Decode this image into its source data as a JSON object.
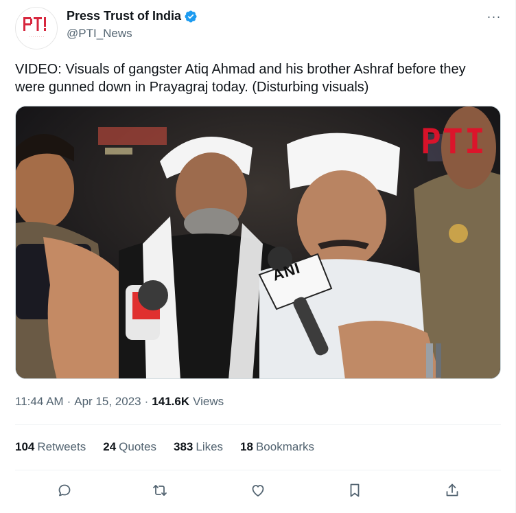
{
  "author": {
    "name": "Press Trust of India",
    "handle": "@PTI_News",
    "avatar_text": "PTI",
    "verified_icon": "verified-badge-icon",
    "verified_color": "#1d9bf0",
    "more_label": "···"
  },
  "tweet": {
    "text": "VIDEO: Visuals of gangster Atiq Ahmad and his brother Ashraf before they were gunned down in Prayagraj today. (Disturbing visuals)"
  },
  "media": {
    "watermark": "PTI",
    "mic_label": "ANI"
  },
  "meta": {
    "time": "11:44 AM",
    "separator": "·",
    "date": "Apr 15, 2023",
    "views_count": "141.6K",
    "views_label": "Views"
  },
  "stats": [
    {
      "count": "104",
      "label": "Retweets"
    },
    {
      "count": "24",
      "label": "Quotes"
    },
    {
      "count": "383",
      "label": "Likes"
    },
    {
      "count": "18",
      "label": "Bookmarks"
    }
  ],
  "actions": [
    "reply-icon",
    "retweet-icon",
    "like-icon",
    "bookmark-icon",
    "share-icon"
  ],
  "colors": {
    "text": "#0f1419",
    "secondary": "#536471",
    "accent": "#1d9bf0",
    "pti_red": "#e0122a"
  }
}
